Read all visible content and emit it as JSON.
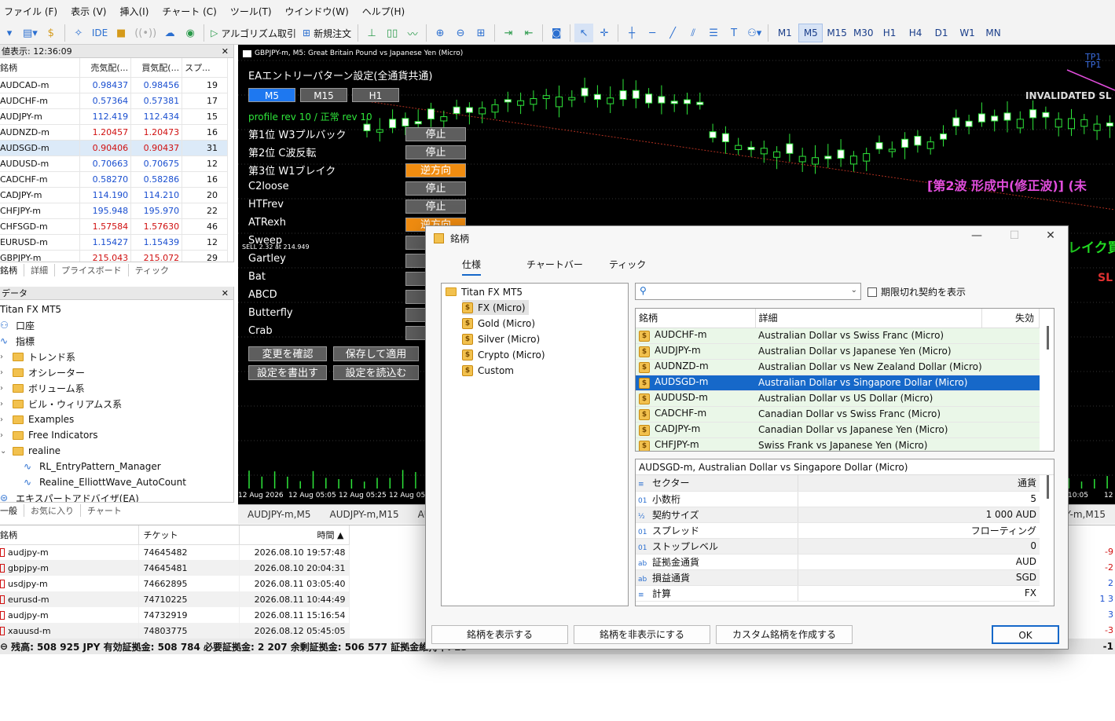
{
  "menu": [
    "ファイル (F)",
    "表示 (V)",
    "挿入(I)",
    "チャート (C)",
    "ツール(T)",
    "ウインドウ(W)",
    "ヘルプ(H)"
  ],
  "toolbar": {
    "algo_trading": "アルゴリズム取引",
    "new_order": "新規注文",
    "ide": "IDE",
    "timeframes": [
      "M1",
      "M5",
      "M15",
      "M30",
      "H1",
      "H4",
      "D1",
      "W1",
      "MN"
    ],
    "active_timeframe": "M5"
  },
  "market_watch": {
    "title": "値表示: 12:36:09",
    "headers": [
      "銘柄",
      "売気配(...",
      "買気配(...",
      "スプ..."
    ],
    "rows": [
      {
        "symbol": "AUDCAD-m",
        "bid": "0.98437",
        "ask": "0.98456",
        "spread": "19"
      },
      {
        "symbol": "AUDCHF-m",
        "bid": "0.57364",
        "ask": "0.57381",
        "spread": "17"
      },
      {
        "symbol": "AUDJPY-m",
        "bid": "112.419",
        "ask": "112.434",
        "spread": "15"
      },
      {
        "symbol": "AUDNZD-m",
        "bid": "1.20457",
        "ask": "1.20473",
        "spread": "16"
      },
      {
        "symbol": "AUDSGD-m",
        "bid": "0.90406",
        "ask": "0.90437",
        "spread": "31"
      },
      {
        "symbol": "AUDUSD-m",
        "bid": "0.70663",
        "ask": "0.70675",
        "spread": "12"
      },
      {
        "symbol": "CADCHF-m",
        "bid": "0.58270",
        "ask": "0.58286",
        "spread": "16"
      },
      {
        "symbol": "CADJPY-m",
        "bid": "114.190",
        "ask": "114.210",
        "spread": "20"
      },
      {
        "symbol": "CHFJPY-m",
        "bid": "195.948",
        "ask": "195.970",
        "spread": "22"
      },
      {
        "symbol": "CHFSGD-m",
        "bid": "1.57584",
        "ask": "1.57630",
        "spread": "46"
      },
      {
        "symbol": "EURUSD-m",
        "bid": "1.15427",
        "ask": "1.15439",
        "spread": "12"
      },
      {
        "symbol": "GBPJPY-m",
        "bid": "215.043",
        "ask": "215.072",
        "spread": "29"
      }
    ],
    "tabs": [
      "銘柄",
      "詳細",
      "プライスボード",
      "ティック"
    ]
  },
  "navigator": {
    "title": "データ",
    "items": [
      "Titan FX MT5",
      "口座",
      "指標",
      "トレンド系",
      "オシレーター",
      "ボリューム系",
      "ビル・ウィリアムス系",
      "Examples",
      "Free Indicators",
      "realine",
      "RL_EntryPattern_Manager",
      "Realine_ElliottWave_AutoCount",
      "エキスパートアドバイザ(EA)"
    ],
    "tabs": [
      "一般",
      "お気に入り",
      "チャート"
    ]
  },
  "chart": {
    "title": "GBPJPY-m, M5:  Great Britain Pound vs Japanese Yen (Micro)",
    "panel_title": "EAエントリーパターン設定(全通貨共通)",
    "tf_buttons": [
      "M5",
      "M15",
      "H1"
    ],
    "profile": "profile rev 10 / 正常 rev 10",
    "patterns": [
      {
        "name": "第1位 W3プルバック",
        "state": "停止"
      },
      {
        "name": "第2位 C波反転",
        "state": "停止"
      },
      {
        "name": "第3位 W1ブレイク",
        "state": "逆方向"
      },
      {
        "name": "C2loose",
        "state": "停止"
      },
      {
        "name": "HTFrev",
        "state": "停止"
      },
      {
        "name": "ATRexh",
        "state": "逆方向"
      },
      {
        "name": "Sweep",
        "state": ""
      },
      {
        "name": "Gartley",
        "state": ""
      },
      {
        "name": "Bat",
        "state": ""
      },
      {
        "name": "ABCD",
        "state": ""
      },
      {
        "name": "Butterfly",
        "state": ""
      },
      {
        "name": "Crab",
        "state": ""
      }
    ],
    "sell_label": "SELL 2.32 at 214.949",
    "buttons": [
      "変更を確認",
      "保存して適用",
      "設定を書出す",
      "設定を読込む"
    ],
    "tp_labels": [
      "TP1",
      "TP1"
    ],
    "invalidated": "INVALIDATED SL",
    "wave_label": "[第2波 形成中(修正波)] (未",
    "side_label_1": "レイク買",
    "side_label_2": "SL",
    "time_labels": [
      "12 Aug 2026",
      "12 Aug 05:05",
      "12 Aug 05:25",
      "12 Aug 05:4",
      "10:05",
      "12 Aug"
    ],
    "chart_tabs": [
      "AUDJPY-m,M5",
      "AUDJPY-m,M15",
      "AUD",
      "Y-m,M15"
    ]
  },
  "terminal": {
    "headers": [
      "銘柄",
      "チケット",
      "時間 ▲"
    ],
    "rows": [
      {
        "symbol": "audjpy-m",
        "ticket": "74645482",
        "time": "2026.08.10 19:57:48",
        "right": "-9"
      },
      {
        "symbol": "gbpjpy-m",
        "ticket": "74645481",
        "time": "2026.08.10 20:04:31",
        "right": "-2"
      },
      {
        "symbol": "usdjpy-m",
        "ticket": "74662895",
        "time": "2026.08.11 03:05:40",
        "right": "2"
      },
      {
        "symbol": "eurusd-m",
        "ticket": "74710225",
        "time": "2026.08.11 10:44:49",
        "right": "1 3"
      },
      {
        "symbol": "audjpy-m",
        "ticket": "74732919",
        "time": "2026.08.11 15:16:54",
        "right": "3"
      },
      {
        "symbol": "xauusd-m",
        "ticket": "74803775",
        "time": "2026.08.12 05:45:05",
        "right": "-3"
      }
    ],
    "status": "残高: 508 925 JPY  有効証拠金: 508 784  必要証拠金: 2 207  余剰証拠金: 506 577  証拠金維持率: 23",
    "status_right": "-1"
  },
  "dialog": {
    "title": "銘柄",
    "tabs": [
      "仕様",
      "チャートバー",
      "ティック"
    ],
    "tree": [
      "Titan FX MT5",
      "FX (Micro)",
      "Gold (Micro)",
      "Silver (Micro)",
      "Crypto (Micro)",
      "Custom"
    ],
    "search_placeholder": "",
    "expired_label": "期限切れ契約を表示",
    "list_headers": [
      "銘柄",
      "詳細",
      "失効"
    ],
    "symbols": [
      {
        "symbol": "AUDCHF-m",
        "desc": "Australian Dollar vs Swiss Franc (Micro)"
      },
      {
        "symbol": "AUDJPY-m",
        "desc": "Australian Dollar vs Japanese Yen (Micro)"
      },
      {
        "symbol": "AUDNZD-m",
        "desc": "Australian Dollar vs New Zealand Dollar (Micro)"
      },
      {
        "symbol": "AUDSGD-m",
        "desc": "Australian Dollar vs Singapore Dollar (Micro)"
      },
      {
        "symbol": "AUDUSD-m",
        "desc": "Australian Dollar vs US Dollar (Micro)"
      },
      {
        "symbol": "CADCHF-m",
        "desc": "Canadian Dollar vs Swiss Franc (Micro)"
      },
      {
        "symbol": "CADJPY-m",
        "desc": "Canadian Dollar vs Japanese Yen (Micro)"
      },
      {
        "symbol": "CHFJPY-m",
        "desc": "Swiss Frank vs Japanese Yen (Micro)"
      }
    ],
    "selected_symbol": "AUDSGD-m",
    "spec_title": "AUDSGD-m, Australian Dollar vs Singapore Dollar (Micro)",
    "spec": [
      {
        "icon": "≡",
        "key": "セクター",
        "value": "通貨"
      },
      {
        "icon": "01",
        "key": "小数桁",
        "value": "5"
      },
      {
        "icon": "½",
        "key": "契約サイズ",
        "value": "1 000 AUD"
      },
      {
        "icon": "01",
        "key": "スプレッド",
        "value": "フローティング"
      },
      {
        "icon": "01",
        "key": "ストップレベル",
        "value": "0"
      },
      {
        "icon": "ab",
        "key": "証拠金通貨",
        "value": "AUD"
      },
      {
        "icon": "ab",
        "key": "損益通貨",
        "value": "SGD"
      },
      {
        "icon": "≡",
        "key": "計算",
        "value": "FX"
      }
    ],
    "buttons": [
      "銘柄を表示する",
      "銘柄を非表示にする",
      "カスタム銘柄を作成する"
    ],
    "ok": "OK"
  }
}
